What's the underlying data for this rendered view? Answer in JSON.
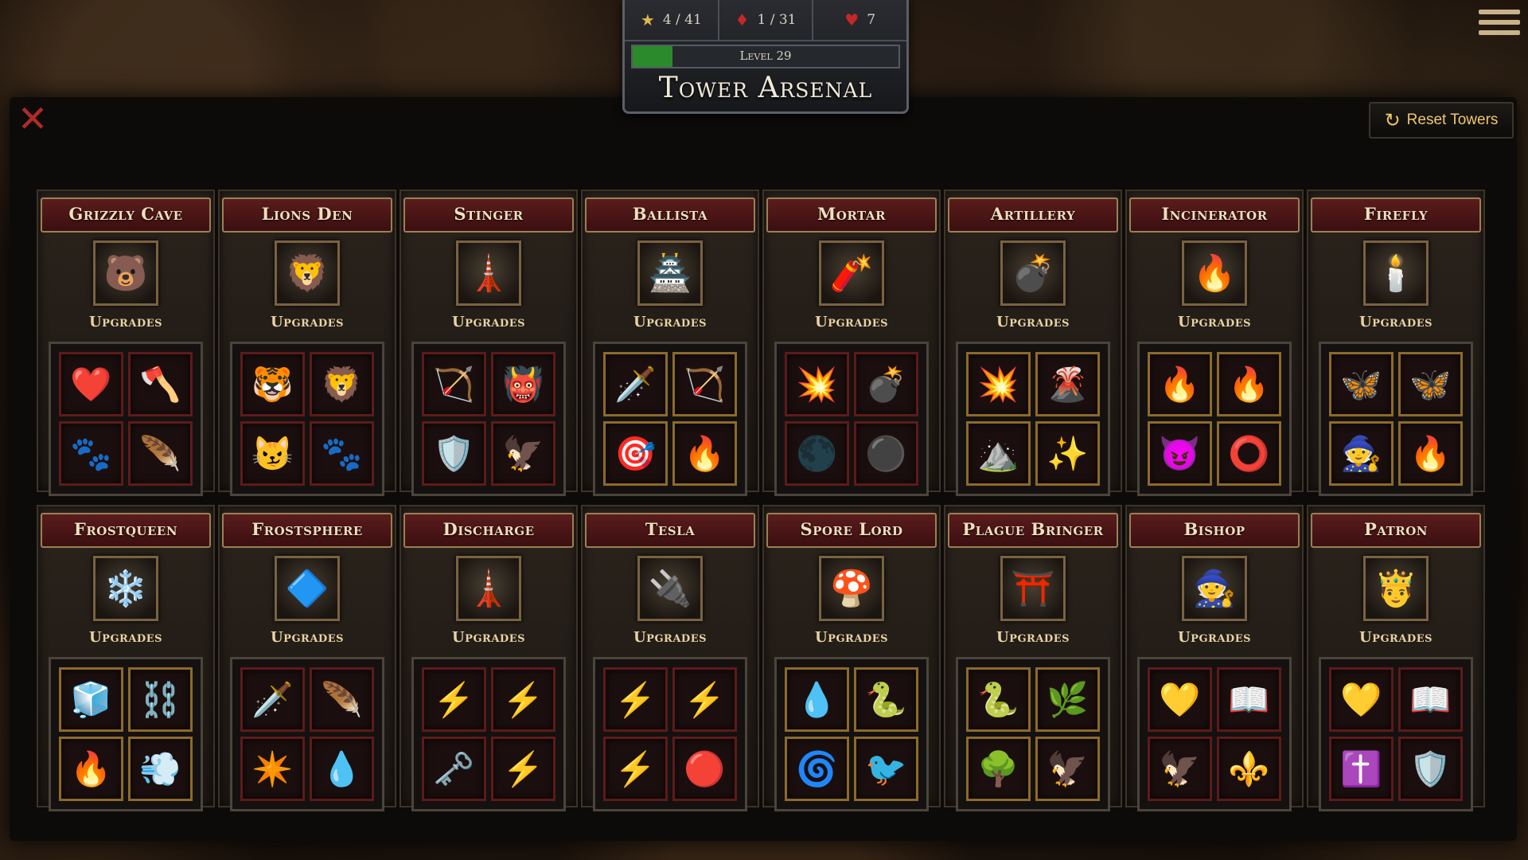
{
  "hud": {
    "stars": "4 / 41",
    "gems": "1 / 31",
    "hearts": "7",
    "level": "Level 29",
    "level_progress": 0.15,
    "title": "Tower Arsenal"
  },
  "reset_label": "Reset Towers",
  "upgrades_label": "Upgrades",
  "towers": [
    {
      "name": "Grizzly Cave",
      "icon": "🐻",
      "ups": [
        "❤️",
        "🪓",
        "🐾",
        "🪶"
      ],
      "gold": false
    },
    {
      "name": "Lions Den",
      "icon": "🦁",
      "ups": [
        "🐯",
        "🦁",
        "😼",
        "🐾"
      ],
      "gold": false
    },
    {
      "name": "Stinger",
      "icon": "🗼",
      "ups": [
        "🏹",
        "👹",
        "🛡️",
        "🦅"
      ],
      "gold": false
    },
    {
      "name": "Ballista",
      "icon": "🏯",
      "ups": [
        "🗡️",
        "🏹",
        "🎯",
        "🔥"
      ],
      "gold": true
    },
    {
      "name": "Mortar",
      "icon": "🧨",
      "ups": [
        "💥",
        "💣",
        "🌑",
        "⚫"
      ],
      "gold": false
    },
    {
      "name": "Artillery",
      "icon": "💣",
      "ups": [
        "💥",
        "🌋",
        "⛰️",
        "✨"
      ],
      "gold": true
    },
    {
      "name": "Incinerator",
      "icon": "🔥",
      "ups": [
        "🔥",
        "🔥",
        "😈",
        "⭕"
      ],
      "gold": true
    },
    {
      "name": "Firefly",
      "icon": "🕯️",
      "ups": [
        "🦋",
        "🦋",
        "🧙",
        "🔥"
      ],
      "gold": true
    },
    {
      "name": "Frostqueen",
      "icon": "❄️",
      "ups": [
        "🧊",
        "⛓️",
        "🔥",
        "💨"
      ],
      "gold": true
    },
    {
      "name": "Frostsphere",
      "icon": "🔷",
      "ups": [
        "🗡️",
        "🪶",
        "✴️",
        "💧"
      ],
      "gold": false
    },
    {
      "name": "Discharge",
      "icon": "🗼",
      "ups": [
        "⚡",
        "⚡",
        "🗝️",
        "⚡"
      ],
      "gold": false
    },
    {
      "name": "Tesla",
      "icon": "🔌",
      "ups": [
        "⚡",
        "⚡",
        "⚡",
        "🔴"
      ],
      "gold": false
    },
    {
      "name": "Spore Lord",
      "icon": "🍄",
      "ups": [
        "💧",
        "🐍",
        "🌀",
        "🐦"
      ],
      "gold": true
    },
    {
      "name": "Plague Bringer",
      "icon": "⛩️",
      "ups": [
        "🐍",
        "🌿",
        "🌳",
        "🦅"
      ],
      "gold": true
    },
    {
      "name": "Bishop",
      "icon": "🧙",
      "ups": [
        "💛",
        "📖",
        "🦅",
        "⚜️"
      ],
      "gold": false
    },
    {
      "name": "Patron",
      "icon": "🤴",
      "ups": [
        "💛",
        "📖",
        "✝️",
        "🛡️"
      ],
      "gold": false
    }
  ],
  "icons": {
    "close": "close-icon",
    "reset": "refresh-icon",
    "menu": "hamburger-menu-icon",
    "star": "star-icon",
    "gem": "red-crystal-icon",
    "heart": "heart-icon"
  },
  "colors": {
    "title_bar": "#5a1c1c",
    "accent_gold": "#f0c66a",
    "close_red": "#b02a2a",
    "level_fill": "#2b8a2b"
  }
}
